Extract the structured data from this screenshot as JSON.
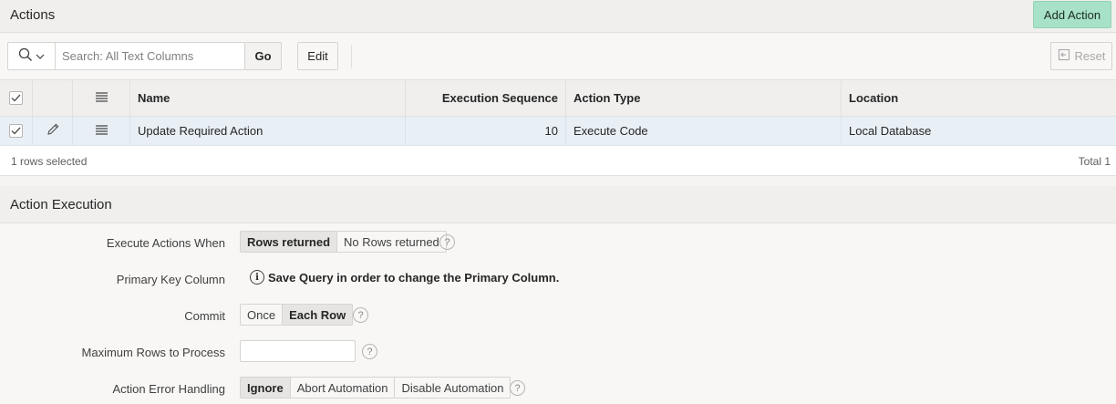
{
  "actions_region": {
    "title": "Actions",
    "add_button": "Add Action"
  },
  "toolbar": {
    "search_placeholder": "Search: All Text Columns",
    "search_value": "",
    "go_label": "Go",
    "edit_label": "Edit",
    "reset_label": "Reset"
  },
  "grid": {
    "columns": {
      "name": "Name",
      "execution_sequence": "Execution Sequence",
      "action_type": "Action Type",
      "location": "Location"
    },
    "rows": [
      {
        "selected": true,
        "name": "Update Required Action",
        "execution_sequence": "10",
        "action_type": "Execute Code",
        "location": "Local Database"
      }
    ],
    "footer": {
      "rows_selected": "1 rows selected",
      "total": "Total 1"
    }
  },
  "execution_region": {
    "title": "Action Execution",
    "fields": {
      "execute_when": {
        "label": "Execute Actions When",
        "options": [
          "Rows returned",
          "No Rows returned"
        ],
        "selected": "Rows returned"
      },
      "primary_key": {
        "label": "Primary Key Column",
        "message": "Save Query in order to change the Primary Column."
      },
      "commit": {
        "label": "Commit",
        "options": [
          "Once",
          "Each Row"
        ],
        "selected": "Each Row"
      },
      "max_rows": {
        "label": "Maximum Rows to Process",
        "value": ""
      },
      "error_handling": {
        "label": "Action Error Handling",
        "options": [
          "Ignore",
          "Abort Automation",
          "Disable Automation"
        ],
        "selected": "Ignore"
      }
    }
  },
  "icons": {
    "search": "search-icon",
    "chevron": "chevron-down-icon",
    "pencil": "pencil-icon",
    "row_menu": "hamburger-icon",
    "reset": "reset-icon",
    "help": "help-icon",
    "info": "info-icon",
    "check": "check-icon"
  },
  "colors": {
    "add_button_bg": "#a8e2c6",
    "selected_row_bg": "#e8eff5"
  }
}
